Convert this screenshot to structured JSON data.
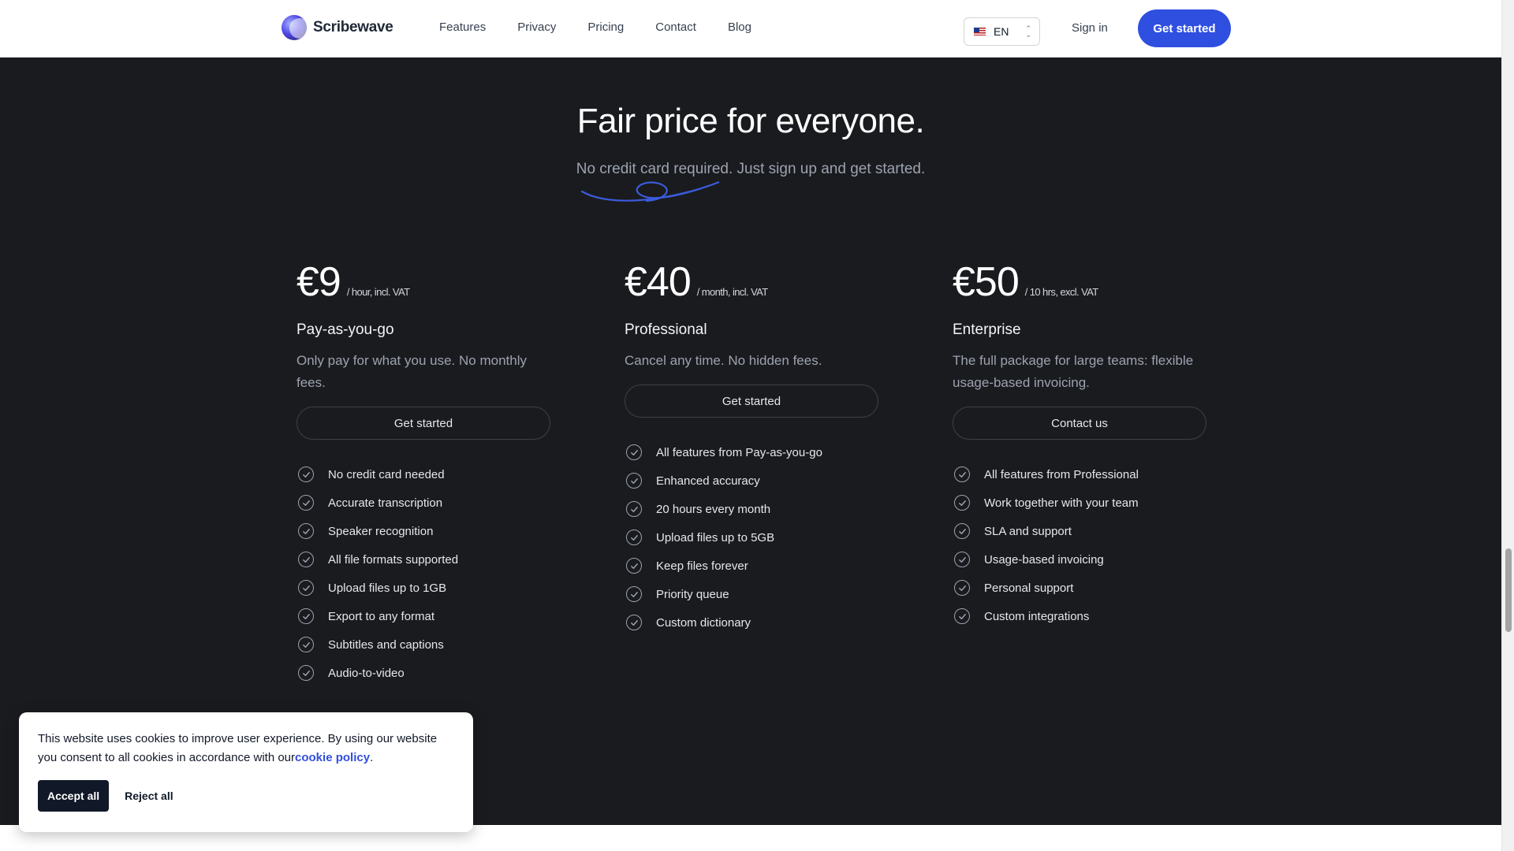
{
  "header": {
    "brand": "Scribewave",
    "nav": [
      "Features",
      "Privacy",
      "Pricing",
      "Contact",
      "Blog"
    ],
    "language": "EN",
    "sign_in": "Sign in",
    "cta": "Get started"
  },
  "pricing": {
    "title": "Fair price for everyone.",
    "subtitle": "No credit card required. Just sign up and get started.",
    "plans": [
      {
        "price": "€9",
        "unit": "/ hour, incl. VAT",
        "name": "Pay-as-you-go",
        "description": "Only pay for what you use. No monthly fees.",
        "button": "Get started",
        "features": [
          "No credit card needed",
          "Accurate transcription",
          "Speaker recognition",
          "All file formats supported",
          "Upload files up to 1GB",
          "Export to any format",
          "Subtitles and captions",
          "Audio-to-video"
        ]
      },
      {
        "price": "€40",
        "unit": "/ month, incl. VAT",
        "name": "Professional",
        "description": "Cancel any time. No hidden fees.",
        "button": "Get started",
        "features": [
          "All features from Pay-as-you-go",
          "Enhanced accuracy",
          "20 hours every month",
          "Upload files up to 5GB",
          "Keep files forever",
          "Priority queue",
          "Custom dictionary"
        ]
      },
      {
        "price": "€50",
        "unit": "/ 10 hrs, excl. VAT",
        "name": "Enterprise",
        "description": "The full package for large teams: flexible usage-based invoicing.",
        "button": "Contact us",
        "features": [
          "All features from Professional",
          "Work together with your team",
          "SLA and support",
          "Usage-based invoicing",
          "Personal support",
          "Custom integrations"
        ]
      }
    ]
  },
  "cookie": {
    "text": "This website uses cookies to improve user experience. By using our website you consent to all cookies in accordance with our",
    "link": "cookie policy",
    "suffix": ".",
    "accept": "Accept all",
    "reject": "Reject all"
  },
  "colors": {
    "accent": "#2f4fe0",
    "section_bg": "#1a1b1f"
  }
}
